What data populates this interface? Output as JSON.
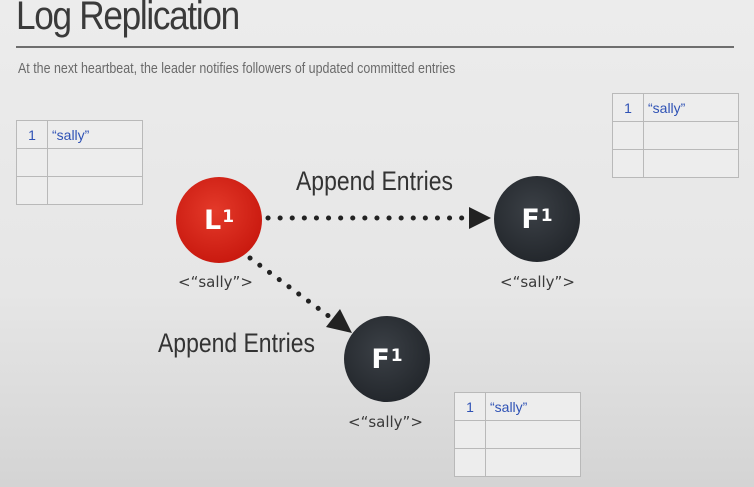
{
  "title": "Log Replication",
  "subtitle": "At the next heartbeat, the leader notifies followers of updated committed entries",
  "leader": {
    "letter": "L",
    "term": "1",
    "value": "<“sally”>",
    "log": [
      {
        "index": "1",
        "value": "“sally”"
      },
      {
        "index": "",
        "value": ""
      },
      {
        "index": "",
        "value": ""
      }
    ]
  },
  "follower_a": {
    "letter": "F",
    "term": "1",
    "value": "<“sally”>",
    "log": [
      {
        "index": "1",
        "value": "“sally”"
      },
      {
        "index": "",
        "value": ""
      },
      {
        "index": "",
        "value": ""
      }
    ]
  },
  "follower_b": {
    "letter": "F",
    "term": "1",
    "value": "<“sally”>",
    "log": [
      {
        "index": "1",
        "value": "“sally”"
      },
      {
        "index": "",
        "value": ""
      },
      {
        "index": "",
        "value": ""
      }
    ]
  },
  "messages": {
    "to_follower_a": "Append Entries",
    "to_follower_b": "Append Entries"
  },
  "colors": {
    "leader": "#d61f14",
    "follower": "#2b3035",
    "log_text": "#2f52b5"
  }
}
